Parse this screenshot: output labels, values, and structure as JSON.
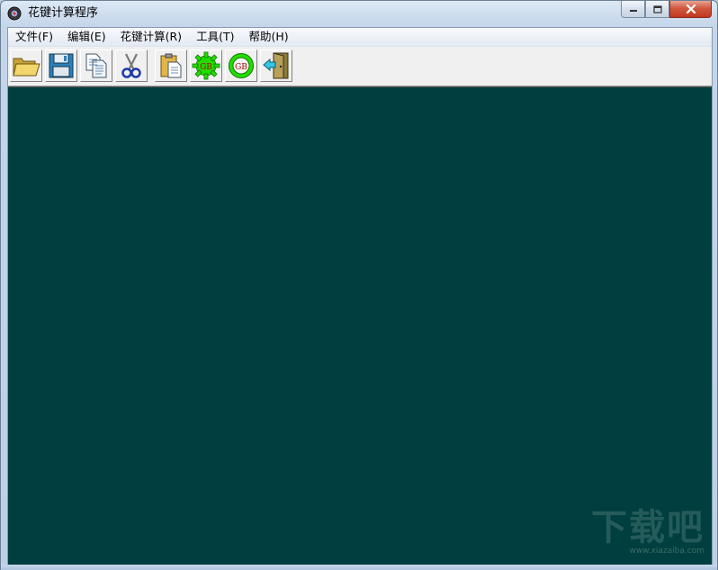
{
  "window": {
    "title": "花键计算程序",
    "controls": {
      "minimize": "minimize",
      "maximize": "maximize",
      "close": "close"
    }
  },
  "menu": [
    {
      "label": "文件(F)"
    },
    {
      "label": "编辑(E)"
    },
    {
      "label": "花键计算(R)"
    },
    {
      "label": "工具(T)"
    },
    {
      "label": "帮助(H)"
    }
  ],
  "toolbar": [
    {
      "icon": "open-folder-icon"
    },
    {
      "icon": "save-disk-icon"
    },
    {
      "icon": "copy-icon"
    },
    {
      "icon": "cut-scissors-icon"
    },
    {
      "icon": "paste-clipboard-icon"
    },
    {
      "icon": "gb-gear-icon",
      "text": "GB"
    },
    {
      "icon": "gb-ring-icon",
      "text": "GB"
    },
    {
      "icon": "exit-door-icon"
    }
  ],
  "colors": {
    "canvas": "#003f3f",
    "accent_green": "#22dd00"
  },
  "watermark": {
    "text": "下载吧",
    "url": "www.xiazaiba.com"
  }
}
